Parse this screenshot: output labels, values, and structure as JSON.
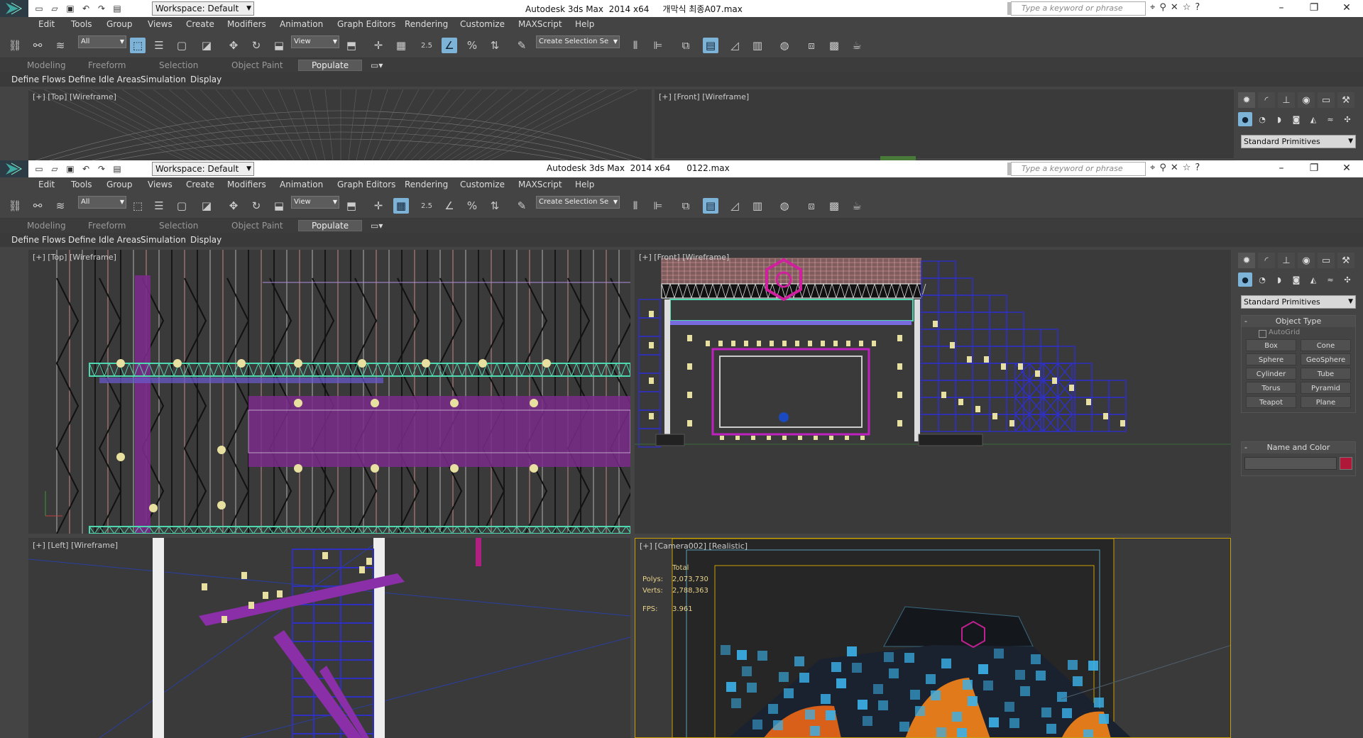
{
  "colors": {
    "cmd_color_swatch": "#b0183a",
    "active_blue": "#7eb3d8"
  },
  "quick_access": [
    "new-icon",
    "open-icon",
    "save-icon",
    "undo-icon",
    "redo-icon",
    "project-icon"
  ],
  "windows": [
    {
      "id": "win1",
      "workspace_label": "Workspace: Default",
      "title": "Autodesk 3ds Max  2014 x64     개막식 최종A07.max",
      "search_placeholder": "Type a keyword or phrase",
      "menu": [
        "Edit",
        "Tools",
        "Group",
        "Views",
        "Create",
        "Modifiers",
        "Animation",
        "Graph Editors",
        "Rendering",
        "Customize",
        "MAXScript",
        "Help"
      ],
      "selection_filter": "All",
      "ref_coord": "View",
      "snap_value": "2.5",
      "named_selection": "Create Selection Se",
      "ribbon_tabs": [
        "Modeling",
        "Freeform",
        "Selection",
        "Object Paint",
        "Populate"
      ],
      "ribbon_active": "Populate",
      "subribbon": [
        "Define Flows",
        "Define Idle Areas",
        "Simulation",
        "Display"
      ],
      "viewports": {
        "top_left": "[+] [Top] [Wireframe]",
        "top_right": "[+] [Front] [Wireframe]"
      },
      "cmd_panel": {
        "dropdown": "Standard Primitives"
      }
    },
    {
      "id": "win2",
      "workspace_label": "Workspace: Default",
      "title": "Autodesk 3ds Max  2014 x64      0122.max",
      "search_placeholder": "Type a keyword or phrase",
      "menu": [
        "Edit",
        "Tools",
        "Group",
        "Views",
        "Create",
        "Modifiers",
        "Animation",
        "Graph Editors",
        "Rendering",
        "Customize",
        "MAXScript",
        "Help"
      ],
      "selection_filter": "All",
      "ref_coord": "View",
      "snap_value": "2.5",
      "named_selection": "Create Selection Se",
      "ribbon_tabs": [
        "Modeling",
        "Freeform",
        "Selection",
        "Object Paint",
        "Populate"
      ],
      "ribbon_active": "Populate",
      "subribbon": [
        "Define Flows",
        "Define Idle Areas",
        "Simulation",
        "Display"
      ],
      "viewports": {
        "top_left": "[+] [Top] [Wireframe]",
        "top_right": "[+] [Front] [Wireframe]",
        "bottom_left": "[+] [Left] [Wireframe]",
        "bottom_right": "[+] [Camera002] [Realistic]"
      },
      "stats": {
        "header": "Total",
        "polys_label": "Polys:",
        "polys": "2,073,730",
        "verts_label": "Verts:",
        "verts": "2,788,363",
        "fps_label": "FPS:",
        "fps": "3.961"
      },
      "cmd_panel": {
        "dropdown": "Standard Primitives",
        "object_type_title": "Object Type",
        "autogrid": "AutoGrid",
        "primitives": [
          "Box",
          "Cone",
          "Sphere",
          "GeoSphere",
          "Cylinder",
          "Tube",
          "Torus",
          "Pyramid",
          "Teapot",
          "Plane"
        ],
        "name_color_title": "Name and Color"
      }
    }
  ]
}
